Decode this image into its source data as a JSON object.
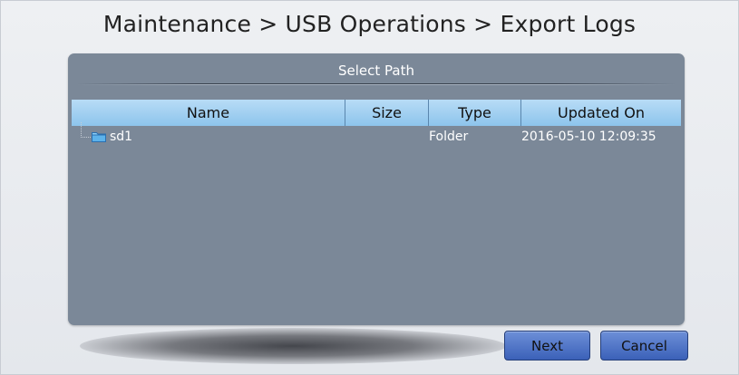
{
  "breadcrumb": "Maintenance > USB Operations > Export Logs",
  "dialog": {
    "title": "Select Path",
    "columns": {
      "name": "Name",
      "size": "Size",
      "type": "Type",
      "updated": "Updated On"
    },
    "rows": [
      {
        "icon": "folder-icon",
        "name": "sd1",
        "size": "",
        "type": "Folder",
        "updated": "2016-05-10 12:09:35"
      }
    ]
  },
  "buttons": {
    "next": "Next",
    "cancel": "Cancel"
  },
  "colors": {
    "dialog_bg": "#7b8898",
    "header_bg": "#a6d0f1",
    "button_bg": "#4a6fc4",
    "folder_icon": "#7cc4f2"
  }
}
